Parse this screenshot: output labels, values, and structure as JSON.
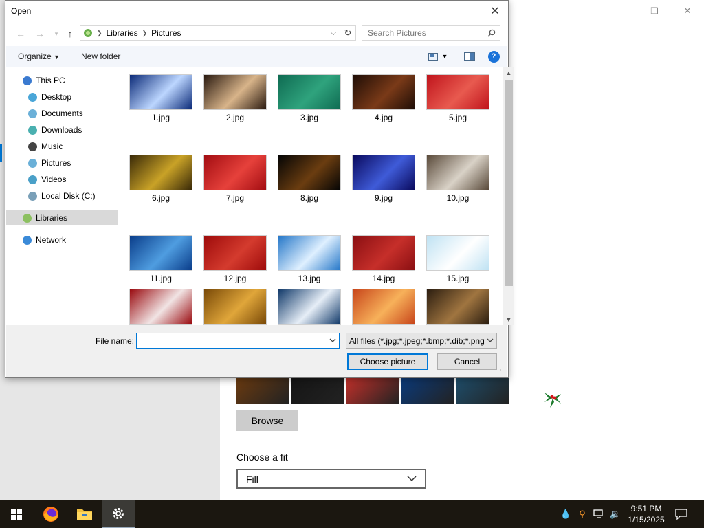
{
  "dialog": {
    "title": "Open",
    "address": [
      "Libraries",
      "Pictures"
    ],
    "search_placeholder": "Search Pictures",
    "toolbar": {
      "organize": "Organize",
      "new_folder": "New folder",
      "help": "?"
    },
    "nav": [
      {
        "label": "This PC",
        "icon": "pc-icon"
      },
      {
        "label": "Desktop",
        "icon": "desktop-icon"
      },
      {
        "label": "Documents",
        "icon": "documents-icon"
      },
      {
        "label": "Downloads",
        "icon": "downloads-icon"
      },
      {
        "label": "Music",
        "icon": "music-icon"
      },
      {
        "label": "Pictures",
        "icon": "pictures-icon"
      },
      {
        "label": "Videos",
        "icon": "videos-icon"
      },
      {
        "label": "Local Disk (C:)",
        "icon": "disk-icon"
      },
      {
        "label": "Libraries",
        "icon": "libraries-icon",
        "selected": true
      },
      {
        "label": "Network",
        "icon": "network-icon"
      }
    ],
    "files": [
      {
        "name": "1.jpg",
        "c1": "#0b2a78",
        "c2": "#bcd6ff"
      },
      {
        "name": "2.jpg",
        "c1": "#2a1a10",
        "c2": "#d8b48a"
      },
      {
        "name": "3.jpg",
        "c1": "#0f6b52",
        "c2": "#2fa37d"
      },
      {
        "name": "4.jpg",
        "c1": "#1e0d06",
        "c2": "#7a3a18"
      },
      {
        "name": "5.jpg",
        "c1": "#c0141c",
        "c2": "#e85a4f"
      },
      {
        "name": "6.jpg",
        "c1": "#3a2a08",
        "c2": "#c9a227"
      },
      {
        "name": "7.jpg",
        "c1": "#a30d12",
        "c2": "#e6413b"
      },
      {
        "name": "8.jpg",
        "c1": "#050505",
        "c2": "#6b3d10"
      },
      {
        "name": "9.jpg",
        "c1": "#0a0a5e",
        "c2": "#3f5bd8"
      },
      {
        "name": "10.jpg",
        "c1": "#5a4a3a",
        "c2": "#d9d2c7"
      },
      {
        "name": "11.jpg",
        "c1": "#0a3d8a",
        "c2": "#4f9de0"
      },
      {
        "name": "12.jpg",
        "c1": "#9e0b0b",
        "c2": "#d43b2e"
      },
      {
        "name": "13.jpg",
        "c1": "#2577c8",
        "c2": "#dff0ff"
      },
      {
        "name": "14.jpg",
        "c1": "#8a0f12",
        "c2": "#c62f2a"
      },
      {
        "name": "15.jpg",
        "c1": "#bfe2f3",
        "c2": "#ffffff"
      },
      {
        "name": "",
        "c1": "#9a0b10",
        "c2": "#f1e4e4"
      },
      {
        "name": "",
        "c1": "#7a4a08",
        "c2": "#e0a63a"
      },
      {
        "name": "",
        "c1": "#123a6a",
        "c2": "#e6eef7"
      },
      {
        "name": "",
        "c1": "#c8461b",
        "c2": "#f7b15a"
      },
      {
        "name": "",
        "c1": "#2c1e10",
        "c2": "#a07540"
      }
    ],
    "filename_label": "File name:",
    "filename_value": "",
    "filter": "All files (*.jpg;*.jpeg;*.bmp;*.dib;*.png",
    "choose_button": "Choose picture",
    "cancel_button": "Cancel"
  },
  "settings": {
    "browse": "Browse",
    "fit_label": "Choose a fit",
    "fit_value": "Fill",
    "thumbs": [
      "#6a3a10",
      "#151515",
      "#c0302a",
      "#0b3a7a",
      "#1e4d6a"
    ]
  },
  "taskbar": {
    "time": "9:51 PM",
    "date": "1/15/2025"
  }
}
